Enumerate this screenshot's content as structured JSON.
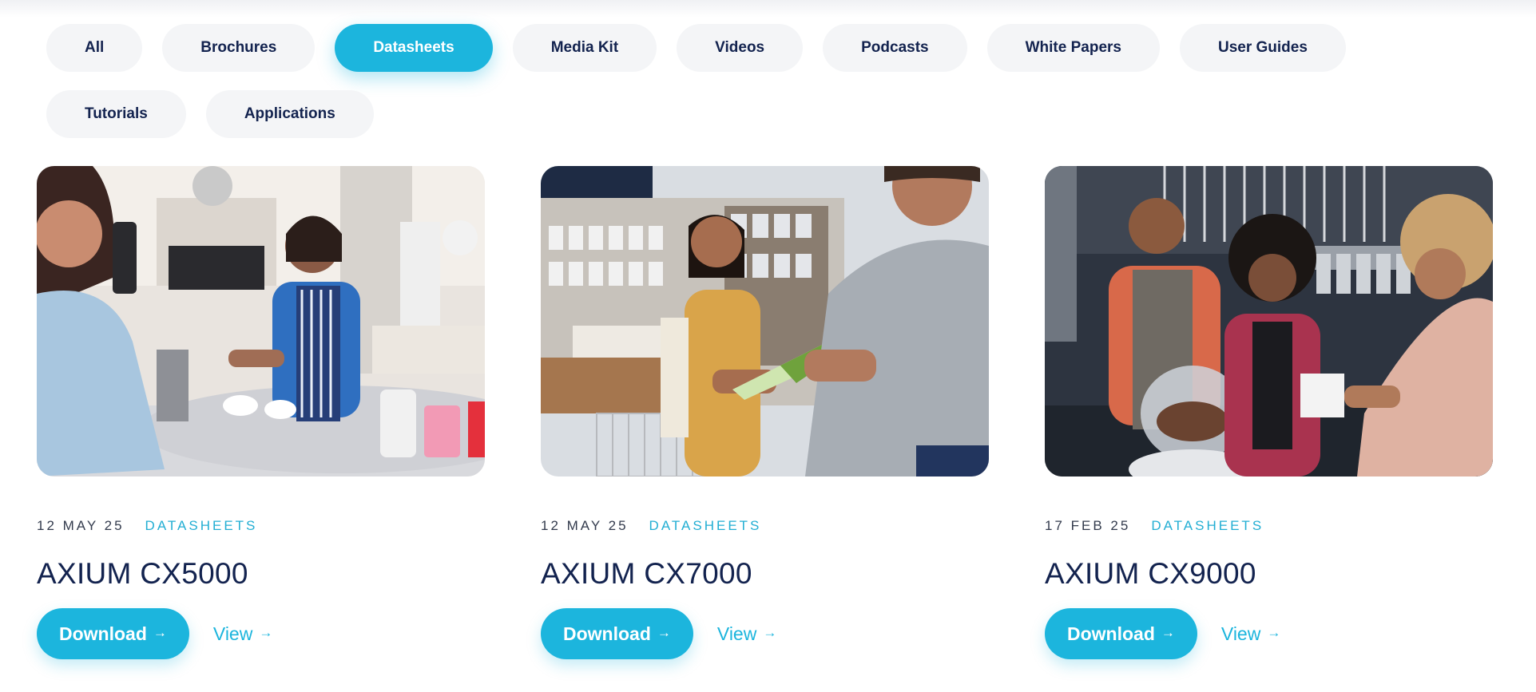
{
  "filters": {
    "items": [
      {
        "label": "All"
      },
      {
        "label": "Brochures"
      },
      {
        "label": "Datasheets"
      },
      {
        "label": "Media Kit"
      },
      {
        "label": "Videos"
      },
      {
        "label": "Podcasts"
      },
      {
        "label": "White Papers"
      },
      {
        "label": "User Guides"
      },
      {
        "label": "Tutorials"
      },
      {
        "label": "Applications"
      }
    ],
    "active": "Datasheets"
  },
  "cards": [
    {
      "date": "12 MAY 25",
      "category": "DATASHEETS",
      "title": "AXIUM CX5000",
      "download_label": "Download",
      "view_label": "View"
    },
    {
      "date": "12 MAY 25",
      "category": "DATASHEETS",
      "title": "AXIUM CX7000",
      "download_label": "Download",
      "view_label": "View"
    },
    {
      "date": "17 FEB 25",
      "category": "DATASHEETS",
      "title": "AXIUM CX9000",
      "download_label": "Download",
      "view_label": "View"
    }
  ],
  "icons": {
    "arrow": "arrow-right-icon"
  },
  "colors": {
    "accent": "#1cb5dd",
    "text_primary": "#13234f",
    "pill_bg": "#f4f5f7"
  }
}
